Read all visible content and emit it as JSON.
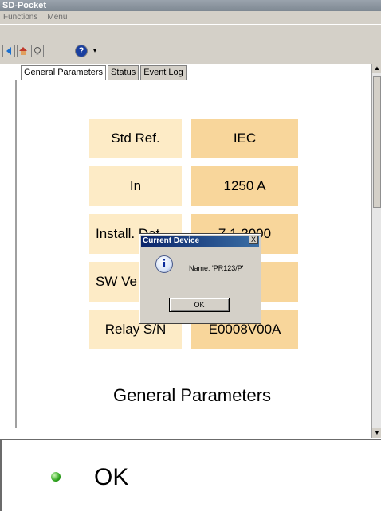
{
  "window": {
    "title": "SD-Pocket"
  },
  "menubar": {
    "items": [
      "Functions",
      "Menu"
    ]
  },
  "toolbar": {
    "buttons": [
      "back-icon",
      "home-icon",
      "bulb-icon",
      "help-icon",
      "dropdown-arrow-icon"
    ]
  },
  "tabs": [
    {
      "label": "General Parameters",
      "active": true
    },
    {
      "label": "Status",
      "active": false
    },
    {
      "label": "Event Log",
      "active": false
    }
  ],
  "params": [
    {
      "label": "Std Ref.",
      "value": "IEC"
    },
    {
      "label": "In",
      "value": "1250 A"
    },
    {
      "label": "Install. Dat",
      "value": "7.1.2000"
    },
    {
      "label": "SW Ve",
      "value": ""
    },
    {
      "label": "Relay S/N",
      "value": "E0008V00A"
    }
  ],
  "section_title": "General Parameters",
  "status": {
    "text": "OK",
    "color": "#2fa51e"
  },
  "dialog": {
    "title": "Current Device",
    "message": "Name: 'PR123/P'",
    "ok_label": "OK",
    "close_label": "X"
  },
  "colors": {
    "label_bg": "#fdebc6",
    "value_bg": "#f8d69b",
    "dialog_title_bg": "#0a246a"
  }
}
